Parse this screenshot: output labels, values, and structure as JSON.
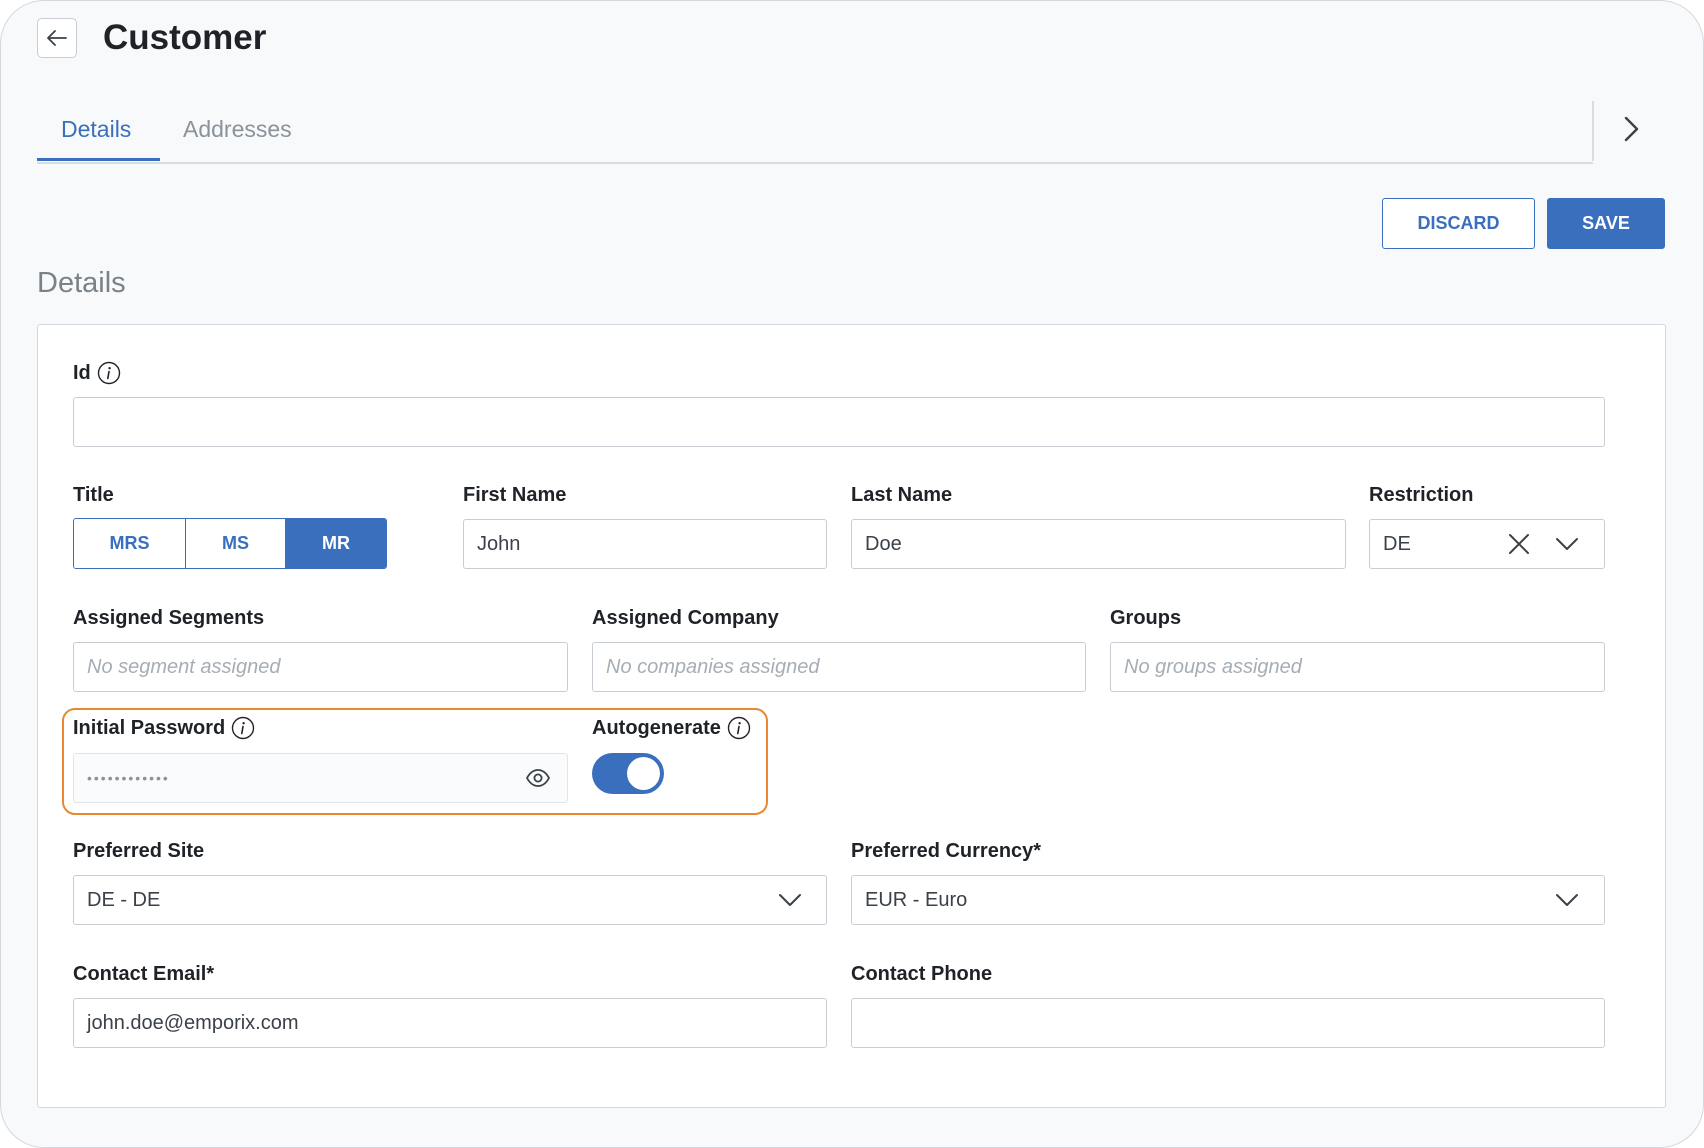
{
  "header": {
    "title": "Customer"
  },
  "tabs": [
    {
      "label": "Details",
      "active": true
    },
    {
      "label": "Addresses",
      "active": false
    }
  ],
  "actions": {
    "discard_label": "DISCARD",
    "save_label": "SAVE"
  },
  "section": {
    "title": "Details"
  },
  "form": {
    "id": {
      "label": "Id",
      "value": ""
    },
    "title": {
      "label": "Title",
      "options": [
        "MRS",
        "MS",
        "MR"
      ],
      "selected": "MR"
    },
    "first_name": {
      "label": "First Name",
      "value": "John"
    },
    "last_name": {
      "label": "Last Name",
      "value": "Doe"
    },
    "restriction": {
      "label": "Restriction",
      "value": "DE"
    },
    "assigned_segments": {
      "label": "Assigned Segments",
      "placeholder": "No segment assigned"
    },
    "assigned_company": {
      "label": "Assigned Company",
      "placeholder": "No companies assigned"
    },
    "groups": {
      "label": "Groups",
      "placeholder": "No groups assigned"
    },
    "initial_password": {
      "label": "Initial Password",
      "value": "••••••••••••"
    },
    "autogenerate": {
      "label": "Autogenerate",
      "enabled": true
    },
    "preferred_site": {
      "label": "Preferred Site",
      "value": "DE - DE"
    },
    "preferred_currency": {
      "label": "Preferred Currency*",
      "value": "EUR - Euro"
    },
    "contact_email": {
      "label": "Contact Email*",
      "value": "john.doe@emporix.com"
    },
    "contact_phone": {
      "label": "Contact Phone",
      "value": ""
    }
  },
  "colors": {
    "accent": "#3a6fbe",
    "highlight": "#e8892f",
    "background": "#f8f9fa"
  },
  "icons": [
    "arrow-left-icon",
    "chevron-right-icon",
    "info-icon",
    "close-icon",
    "chevron-down-icon",
    "eye-icon"
  ]
}
